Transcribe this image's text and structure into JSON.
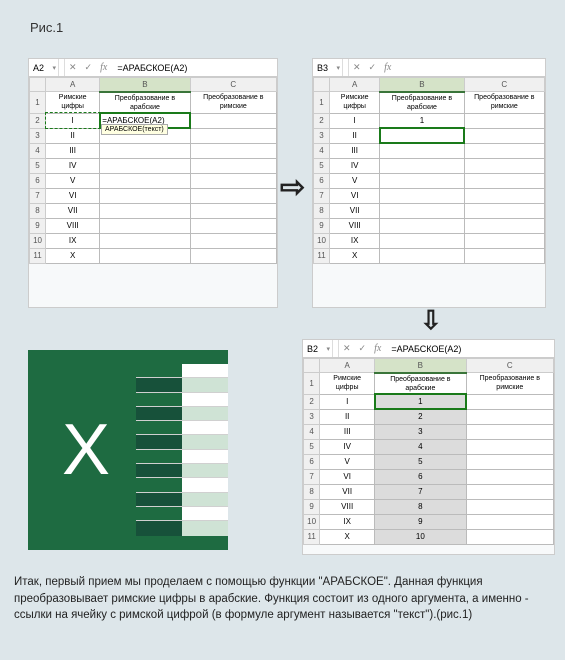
{
  "figure_label": "Рис.1",
  "arrows": {
    "right": "⇨",
    "down": "⇩"
  },
  "panel1": {
    "cell_ref": "A2",
    "btn_cancel": "✕",
    "btn_accept": "✓",
    "btn_fx": "fx",
    "formula": "=АРАБСКОЕ(A2)",
    "cols": [
      "A",
      "B",
      "C"
    ],
    "rows": [
      "1",
      "2",
      "3",
      "4",
      "5",
      "6",
      "7",
      "8",
      "9",
      "10",
      "11"
    ],
    "headers": [
      "Римские цифры",
      "Преобразование в арабские",
      "Преобразование в римские"
    ],
    "roman": [
      "I",
      "II",
      "III",
      "IV",
      "V",
      "VI",
      "VII",
      "VIII",
      "IX",
      "X"
    ],
    "colB": [
      "=АРАБСКОЕ(A2)",
      "",
      "",
      "",
      "",
      "",
      "",
      "",
      "",
      ""
    ],
    "tooltip": "АРАБСКОЕ(текст)"
  },
  "panel2": {
    "cell_ref": "B3",
    "btn_cancel": "✕",
    "btn_accept": "✓",
    "btn_fx": "fx",
    "formula": "",
    "cols": [
      "A",
      "B",
      "C"
    ],
    "rows": [
      "1",
      "2",
      "3",
      "4",
      "5",
      "6",
      "7",
      "8",
      "9",
      "10",
      "11"
    ],
    "headers": [
      "Римские цифры",
      "Преобразование в арабские",
      "Преобразование в римские"
    ],
    "roman": [
      "I",
      "II",
      "III",
      "IV",
      "V",
      "VI",
      "VII",
      "VIII",
      "IX",
      "X"
    ],
    "colB": [
      "1",
      "",
      "",
      "",
      "",
      "",
      "",
      "",
      "",
      ""
    ]
  },
  "panel3": {
    "cell_ref": "B2",
    "btn_cancel": "✕",
    "btn_accept": "✓",
    "btn_fx": "fx",
    "formula": "=АРАБСКОЕ(A2)",
    "cols": [
      "A",
      "B",
      "C"
    ],
    "rows": [
      "1",
      "2",
      "3",
      "4",
      "5",
      "6",
      "7",
      "8",
      "9",
      "10",
      "11"
    ],
    "headers": [
      "Римские цифры",
      "Преобразование в арабские",
      "Преобразование в римские"
    ],
    "roman": [
      "I",
      "II",
      "III",
      "IV",
      "V",
      "VI",
      "VII",
      "VIII",
      "IX",
      "X"
    ],
    "colB": [
      "1",
      "2",
      "3",
      "4",
      "5",
      "6",
      "7",
      "8",
      "9",
      "10"
    ]
  },
  "logo": {
    "letter": "X"
  },
  "caption": "Итак, первый прием мы проделаем с помощью функции \"АРАБСКОЕ\". Данная функция преобразовывает римские цифры в арабские. Функция состоит из одного аргумента, а именно - ссылки на ячейку с римской цифрой (в формуле аргумент называется \"текст\").(рис.1)",
  "chart_data": {
    "type": "table",
    "title": "Roman to Arabic conversion (АРАБСКОЕ function)",
    "columns": [
      "Римские цифры",
      "Преобразование в арабские"
    ],
    "rows": [
      [
        "I",
        1
      ],
      [
        "II",
        2
      ],
      [
        "III",
        3
      ],
      [
        "IV",
        4
      ],
      [
        "V",
        5
      ],
      [
        "VI",
        6
      ],
      [
        "VII",
        7
      ],
      [
        "VIII",
        8
      ],
      [
        "IX",
        9
      ],
      [
        "X",
        10
      ]
    ]
  }
}
